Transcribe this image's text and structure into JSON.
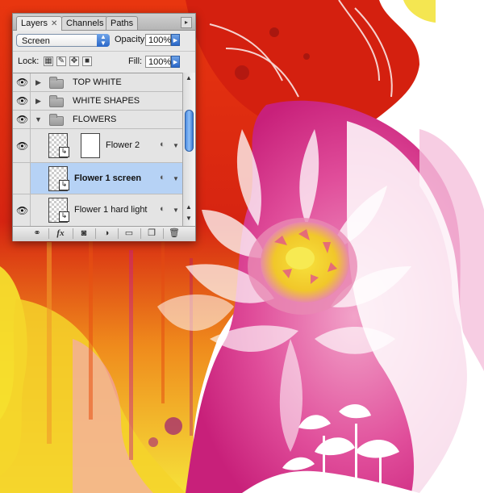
{
  "palette": {
    "tabs": [
      {
        "label": "Layers",
        "active": true,
        "closable": true
      },
      {
        "label": "Channels",
        "active": false
      },
      {
        "label": "Paths",
        "active": false
      }
    ],
    "blend_mode": "Screen",
    "opacity_label": "Opacity:",
    "opacity_value": "100%",
    "lock_label": "Lock:",
    "fill_label": "Fill:",
    "fill_value": "100%",
    "lock_icons": [
      "lock-transparent-pixels-icon",
      "lock-image-pixels-icon",
      "lock-position-icon",
      "lock-all-icon"
    ],
    "layers": [
      {
        "name": "TOP WHITE",
        "type": "group",
        "expanded": false,
        "visible": true,
        "selected": false
      },
      {
        "name": "WHITE SHAPES",
        "type": "group",
        "expanded": false,
        "visible": true,
        "selected": false
      },
      {
        "name": "FLOWERS",
        "type": "group",
        "expanded": true,
        "visible": true,
        "selected": false
      },
      {
        "name": "Flower 2",
        "type": "layer",
        "has_mask": true,
        "visible": true,
        "selected": false
      },
      {
        "name": "Flower 1 screen",
        "type": "layer",
        "has_mask": false,
        "visible": false,
        "selected": true
      },
      {
        "name": "Flower 1 hard light",
        "type": "layer",
        "has_mask": false,
        "visible": true,
        "selected": false
      }
    ],
    "footer_buttons": [
      "link-layers-icon",
      "fx-icon",
      "add-mask-icon",
      "adjustment-layer-icon",
      "new-group-icon",
      "new-layer-icon",
      "trash-icon"
    ],
    "fx_label": "fx"
  },
  "artwork": {
    "colors": {
      "red": "#d8220f",
      "orange": "#ef7a14",
      "yellow": "#f5df2a",
      "magenta": "#e2368f",
      "pink": "#f4a7cd",
      "white": "#ffffff"
    }
  }
}
